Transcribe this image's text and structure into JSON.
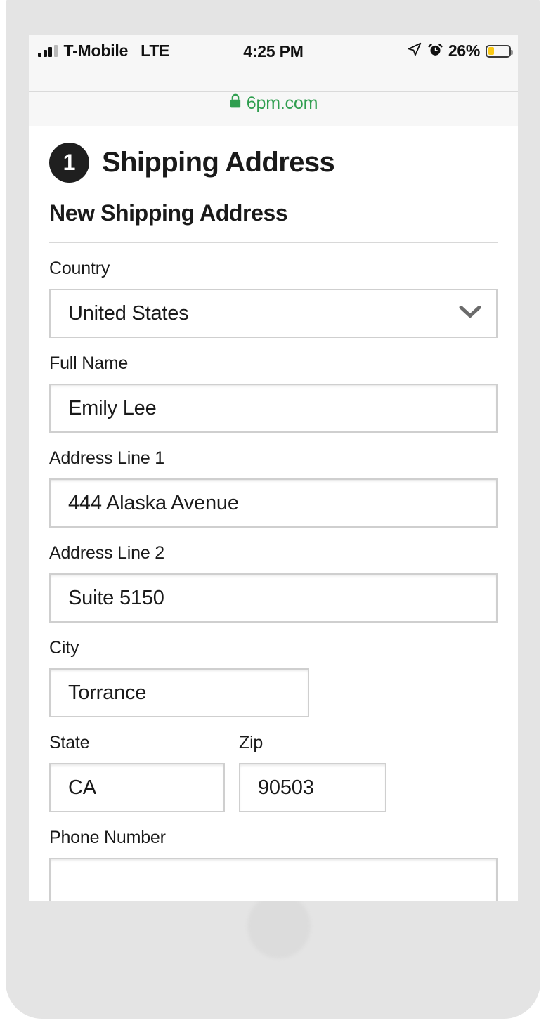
{
  "status_bar": {
    "carrier": "T-Mobile",
    "network": "LTE",
    "time": "4:25 PM",
    "battery_percent": "26%",
    "battery_level": 26,
    "battery_color": "#f9c915",
    "icons": [
      "signal-bars-icon",
      "location-arrow-icon",
      "alarm-clock-icon",
      "battery-icon"
    ]
  },
  "url_bar": {
    "domain": "6pm.com",
    "secure_icon": "lock-icon",
    "secure_color": "#2f9e4f"
  },
  "checkout": {
    "step_number": "1",
    "step_title": "Shipping Address",
    "sub_title": "New Shipping Address",
    "badge_color": "#1f1f1f",
    "fields": {
      "country": {
        "label": "Country",
        "value": "United States",
        "type": "select",
        "chevron": "chevron-down-icon"
      },
      "full_name": {
        "label": "Full Name",
        "value": "Emily Lee",
        "type": "text"
      },
      "address_line_1": {
        "label": "Address Line 1",
        "value": "444 Alaska Avenue",
        "type": "text"
      },
      "address_line_2": {
        "label": "Address Line 2",
        "value": "Suite 5150",
        "type": "text"
      },
      "city": {
        "label": "City",
        "value": "Torrance",
        "type": "text"
      },
      "state": {
        "label": "State",
        "value": "CA",
        "type": "text"
      },
      "zip": {
        "label": "Zip",
        "value": "90503",
        "type": "text"
      },
      "phone_number": {
        "label": "Phone Number",
        "value": "",
        "type": "text"
      }
    }
  }
}
